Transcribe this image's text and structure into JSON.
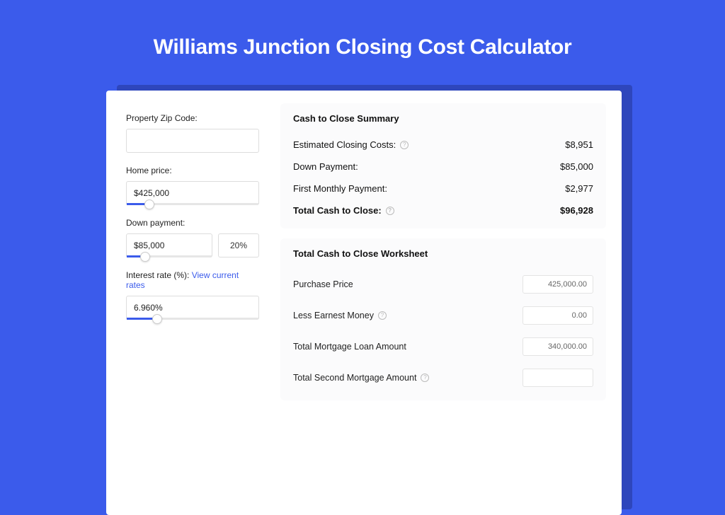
{
  "title": "Williams Junction Closing Cost Calculator",
  "left": {
    "zip_label": "Property Zip Code:",
    "zip_value": "",
    "home_price_label": "Home price:",
    "home_price_value": "$425,000",
    "home_price_fill_pct": "17%",
    "down_payment_label": "Down payment:",
    "down_payment_value": "$85,000",
    "down_payment_pct": "20%",
    "down_payment_fill_pct": "22%",
    "interest_label": "Interest rate (%): ",
    "interest_link": "View current rates",
    "interest_value": "6.960%",
    "interest_fill_pct": "23%"
  },
  "summary": {
    "title": "Cash to Close Summary",
    "rows": [
      {
        "label": "Estimated Closing Costs:",
        "help": true,
        "value": "$8,951",
        "total": false
      },
      {
        "label": "Down Payment:",
        "help": false,
        "value": "$85,000",
        "total": false
      },
      {
        "label": "First Monthly Payment:",
        "help": false,
        "value": "$2,977",
        "total": false
      },
      {
        "label": "Total Cash to Close:",
        "help": true,
        "value": "$96,928",
        "total": true
      }
    ]
  },
  "worksheet": {
    "title": "Total Cash to Close Worksheet",
    "rows": [
      {
        "label": "Purchase Price",
        "help": false,
        "value": "425,000.00"
      },
      {
        "label": "Less Earnest Money",
        "help": true,
        "value": "0.00"
      },
      {
        "label": "Total Mortgage Loan Amount",
        "help": false,
        "value": "340,000.00"
      },
      {
        "label": "Total Second Mortgage Amount",
        "help": true,
        "value": ""
      }
    ]
  }
}
